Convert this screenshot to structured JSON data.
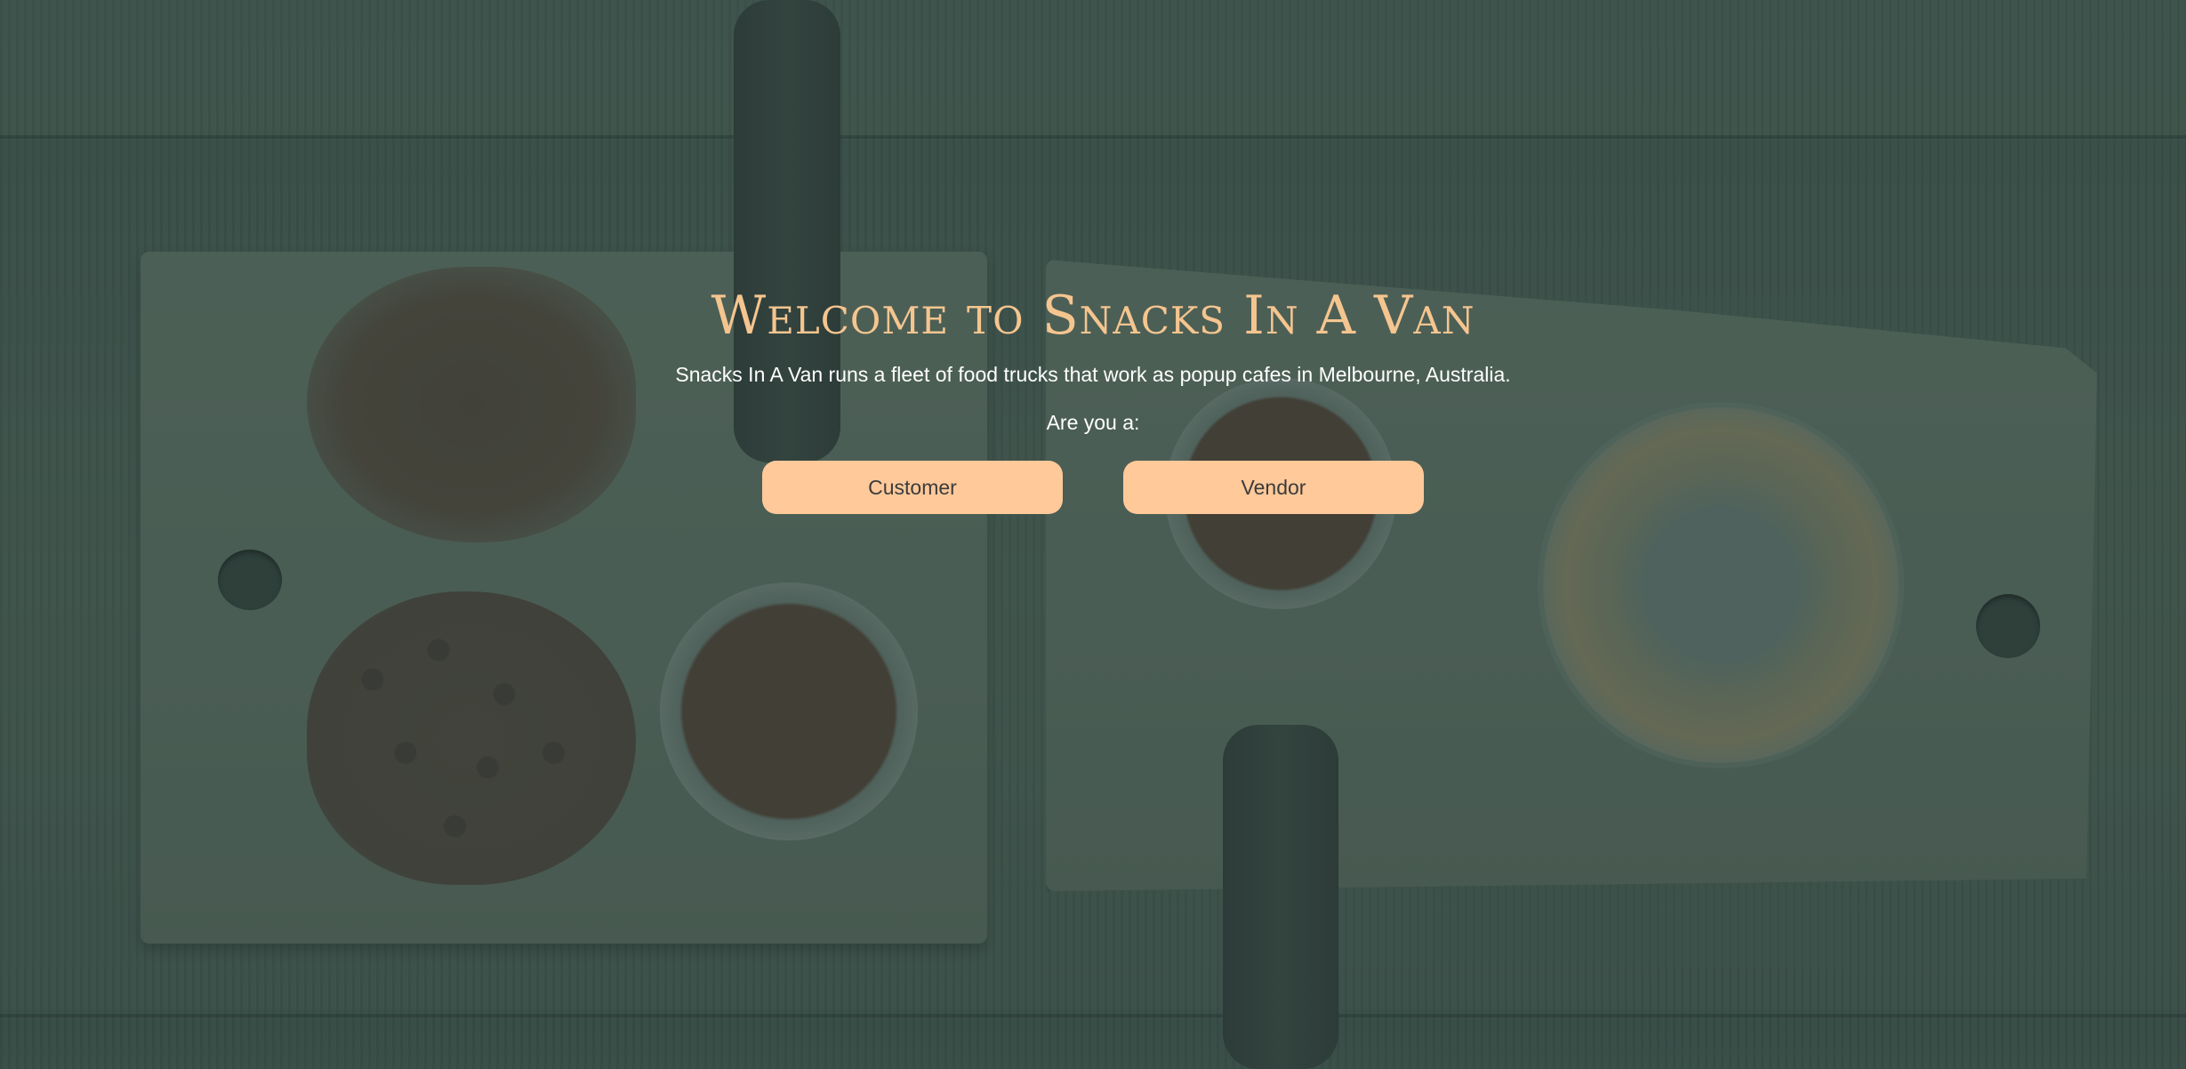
{
  "page": {
    "title": "Welcome to Snacks In A Van",
    "tagline": "Snacks In A Van runs a fleet of food trucks that work as popup cafes in Melbourne, Australia.",
    "prompt": "Are you a:",
    "buttons": {
      "customer_label": "Customer",
      "vendor_label": "Vendor"
    }
  },
  "colors": {
    "title": "#f5c58f",
    "button_background": "#ffc99a",
    "button_text": "#3b3b3b",
    "body_text": "#ffffff",
    "overlay_tint": "#3f5551"
  },
  "background": {
    "image": "coffee-beans-grounds-portafilters-latte-on-wooden-boards"
  }
}
